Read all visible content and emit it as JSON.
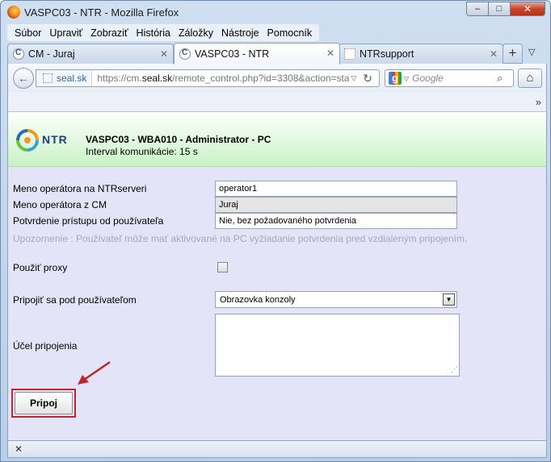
{
  "window": {
    "title": "VASPC03 - NTR - Mozilla Firefox",
    "controls": {
      "minimize": "–",
      "maximize": "□",
      "close": "✕"
    }
  },
  "menubar": {
    "items": [
      "Súbor",
      "Upraviť",
      "Zobraziť",
      "História",
      "Záložky",
      "Nástroje",
      "Pomocník"
    ]
  },
  "tabs": [
    {
      "label": "CM - Juraj",
      "icon": "chrome-icon",
      "active": false
    },
    {
      "label": "VASPC03 - NTR",
      "icon": "chrome-icon",
      "active": true
    },
    {
      "label": "NTRsupport",
      "icon": "blank-page-icon",
      "active": false
    }
  ],
  "tabbar": {
    "close_glyph": "✕",
    "new_tab_glyph": "+",
    "list_glyph": "▽"
  },
  "navbar": {
    "back_glyph": "←",
    "site_name": "seal.sk",
    "url_prefix": "https://cm.",
    "url_domain": "seal.sk",
    "url_rest": "/remote_control.php?id=3308&action=sta",
    "dropdown_glyph": "▽",
    "reload_glyph": "↻",
    "search_placeholder": "Google",
    "search_engine_glyph": "g",
    "search_glyph": "⌕",
    "home_glyph": "⌂",
    "more_glyph": "»"
  },
  "header": {
    "logo_text": "NTR",
    "title": "VASPC03 - WBA010 - Administrator - PC",
    "subtitle": "Interval komunikácie: 15 s"
  },
  "form": {
    "operator_ntr_label": "Meno operátora na NTRserveri",
    "operator_ntr_value": "operator1",
    "operator_cm_label": "Meno operátora z CM",
    "operator_cm_value": "Juraj",
    "confirm_label": "Potvrdenie prístupu od používateľa",
    "confirm_value": "Nie, bez požadovaného potvrdenia",
    "warning": "Upozornenie : Používateľ môže mať aktivované na PC vyžiadanie potvrdenia pred vzdialeným pripojením.",
    "proxy_label": "Použiť proxy",
    "proxy_checked": false,
    "connect_as_label": "Pripojiť sa pod používateľom",
    "connect_as_value": "Obrazovka konzoly",
    "purpose_label": "Účel pripojenia",
    "purpose_value": "",
    "connect_button": "Pripoj",
    "select_arrow_glyph": "▼",
    "grip_glyph": "⋰"
  },
  "statusbar": {
    "close_glyph": "✕"
  },
  "colors": {
    "accent_highlight": "#c0272d",
    "header_gradient_end": "#c8f2c4",
    "content_bg": "#e4e4f8",
    "warning_text": "#a7a7b8"
  }
}
